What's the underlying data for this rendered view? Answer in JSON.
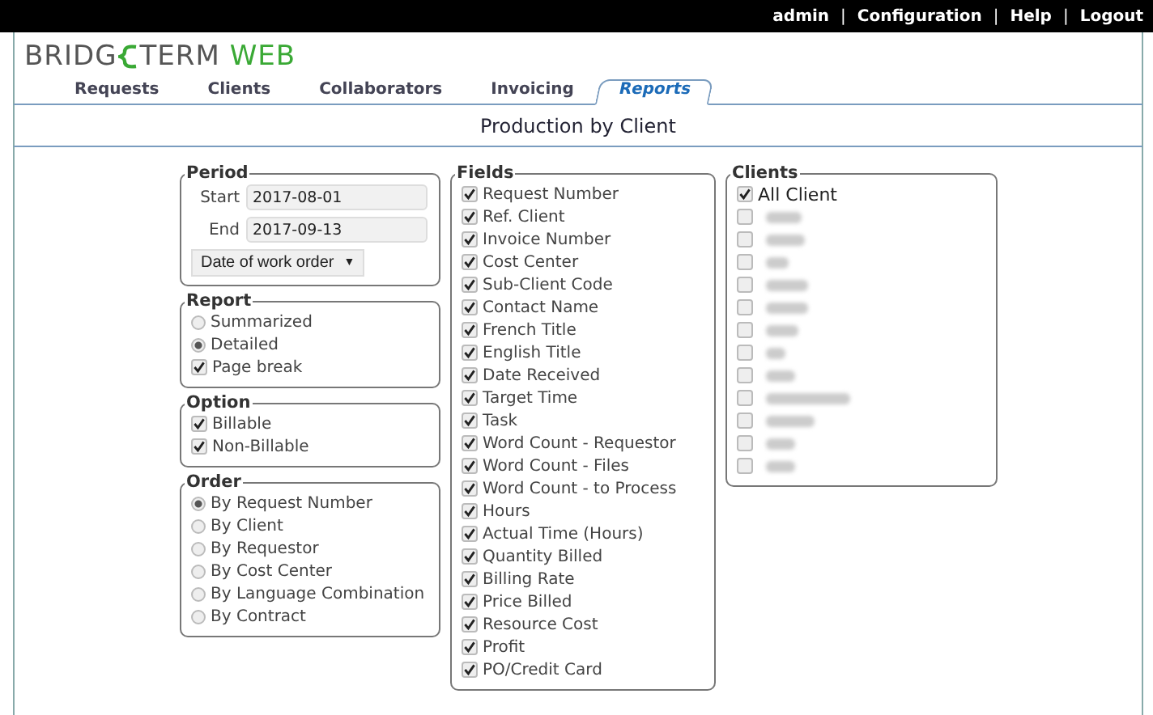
{
  "top_bar": {
    "links": [
      "admin",
      "Configuration",
      "Help",
      "Logout"
    ],
    "separator": "|"
  },
  "logo": {
    "before_mark": "BRIDG",
    "after_mark": "TERM",
    "suffix": "WEB"
  },
  "tabs": [
    {
      "label": "Requests",
      "selected": false
    },
    {
      "label": "Clients",
      "selected": false
    },
    {
      "label": "Collaborators",
      "selected": false
    },
    {
      "label": "Invoicing",
      "selected": false
    },
    {
      "label": "Reports",
      "selected": true
    }
  ],
  "page_title": "Production by Client",
  "period": {
    "legend": "Period",
    "start_label": "Start",
    "start_value": "2017-08-01",
    "end_label": "End",
    "end_value": "2017-09-13",
    "date_select": "Date of work order",
    "caret": "▼"
  },
  "report": {
    "legend": "Report",
    "options": [
      {
        "kind": "radio",
        "label": "Summarized",
        "selected": false
      },
      {
        "kind": "radio",
        "label": "Detailed",
        "selected": true
      },
      {
        "kind": "checkbox",
        "label": "Page break",
        "checked": true
      }
    ]
  },
  "option": {
    "legend": "Option",
    "items": [
      {
        "label": "Billable",
        "checked": true
      },
      {
        "label": "Non-Billable",
        "checked": true
      }
    ]
  },
  "order": {
    "legend": "Order",
    "options": [
      {
        "label": "By Request Number",
        "selected": true
      },
      {
        "label": "By Client",
        "selected": false
      },
      {
        "label": "By Requestor",
        "selected": false
      },
      {
        "label": "By Cost Center",
        "selected": false
      },
      {
        "label": "By Language Combination",
        "selected": false
      },
      {
        "label": "By Contract",
        "selected": false
      }
    ]
  },
  "fields": {
    "legend": "Fields",
    "items": [
      {
        "label": "Request Number",
        "checked": true
      },
      {
        "label": "Ref. Client",
        "checked": true
      },
      {
        "label": "Invoice Number",
        "checked": true
      },
      {
        "label": "Cost Center",
        "checked": true
      },
      {
        "label": "Sub-Client Code",
        "checked": true
      },
      {
        "label": "Contact Name",
        "checked": true
      },
      {
        "label": "French Title",
        "checked": true
      },
      {
        "label": "English Title",
        "checked": true
      },
      {
        "label": "Date Received",
        "checked": true
      },
      {
        "label": "Target Time",
        "checked": true
      },
      {
        "label": "Task",
        "checked": true
      },
      {
        "label": "Word Count - Requestor",
        "checked": true
      },
      {
        "label": "Word Count - Files",
        "checked": true
      },
      {
        "label": "Word Count - to Process",
        "checked": true
      },
      {
        "label": "Hours",
        "checked": true
      },
      {
        "label": "Actual Time (Hours)",
        "checked": true
      },
      {
        "label": "Quantity Billed",
        "checked": true
      },
      {
        "label": "Billing Rate",
        "checked": true
      },
      {
        "label": "Price Billed",
        "checked": true
      },
      {
        "label": "Resource Cost",
        "checked": true
      },
      {
        "label": "Profit",
        "checked": true
      },
      {
        "label": "PO/Credit Card",
        "checked": true
      }
    ]
  },
  "clients": {
    "legend": "Clients",
    "items": [
      {
        "kind": "labeled",
        "label": "All Client",
        "checked": true
      },
      {
        "kind": "redacted",
        "checked": false
      },
      {
        "kind": "redacted",
        "checked": false
      },
      {
        "kind": "redacted",
        "checked": false
      },
      {
        "kind": "redacted",
        "checked": false
      },
      {
        "kind": "redacted",
        "checked": false
      },
      {
        "kind": "redacted",
        "checked": false
      },
      {
        "kind": "redacted",
        "checked": false
      },
      {
        "kind": "redacted",
        "checked": false
      },
      {
        "kind": "redacted",
        "checked": false
      },
      {
        "kind": "redacted",
        "checked": false
      },
      {
        "kind": "redacted",
        "checked": false
      },
      {
        "kind": "redacted",
        "checked": false
      }
    ]
  }
}
